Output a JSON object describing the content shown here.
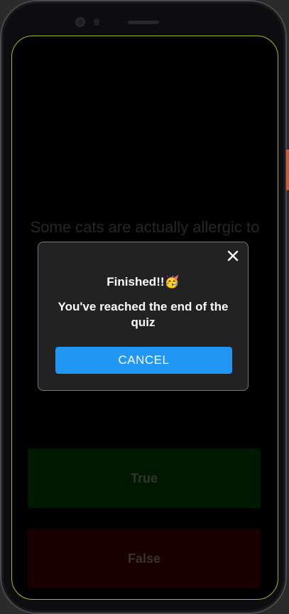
{
  "question": {
    "text": "Some cats are actually allergic to humans"
  },
  "answers": {
    "true_label": "True",
    "false_label": "False"
  },
  "dialog": {
    "title": "Finished!!🥳",
    "message": "You've reached the end of the quiz",
    "cancel_label": "CANCEL",
    "close_icon": "close-icon"
  },
  "colors": {
    "dialog_bg": "#222222",
    "button_accent": "#2196f3",
    "true_bg": "#001a00",
    "false_bg": "#1a0000"
  }
}
